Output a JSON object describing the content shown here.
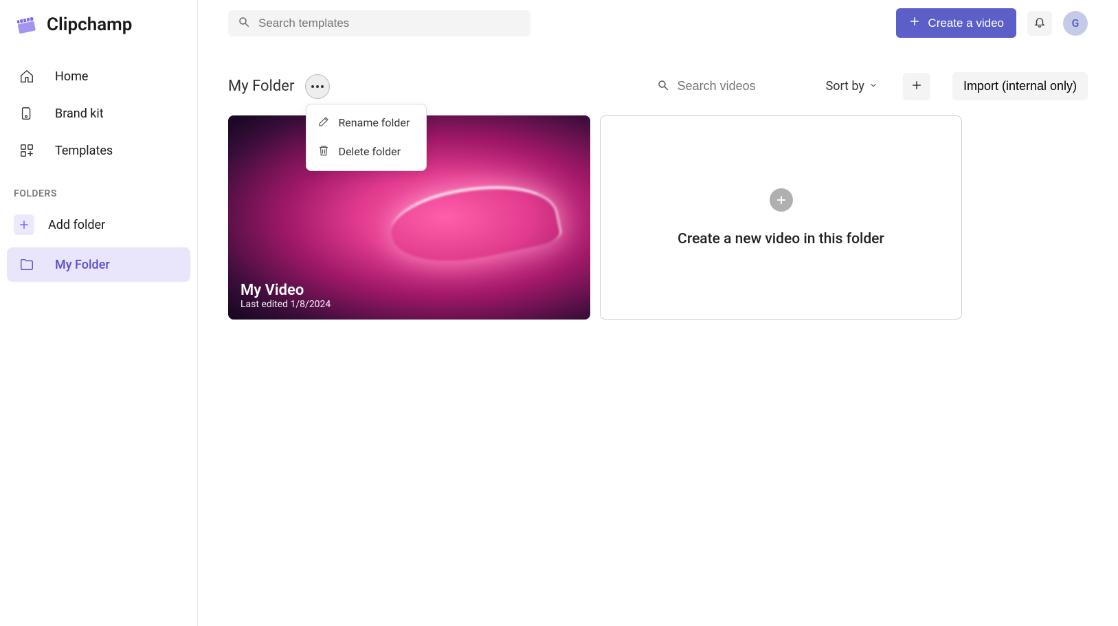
{
  "brand": {
    "name": "Clipchamp"
  },
  "sidebar": {
    "nav": [
      {
        "label": "Home"
      },
      {
        "label": "Brand kit"
      },
      {
        "label": "Templates"
      }
    ],
    "folders_label": "FOLDERS",
    "add_folder_label": "Add folder",
    "folders": [
      {
        "label": "My Folder"
      }
    ]
  },
  "topbar": {
    "search_placeholder": "Search templates",
    "create_video_label": "Create a video",
    "avatar_initial": "G"
  },
  "folder": {
    "title": "My Folder",
    "menu": {
      "rename": "Rename folder",
      "delete": "Delete folder"
    },
    "search_placeholder": "Search videos",
    "sort_label": "Sort by",
    "import_label": "Import (internal only)"
  },
  "videos": [
    {
      "title": "My Video",
      "subtitle": "Last edited 1/8/2024"
    }
  ],
  "new_video_card_label": "Create a new video in this folder"
}
